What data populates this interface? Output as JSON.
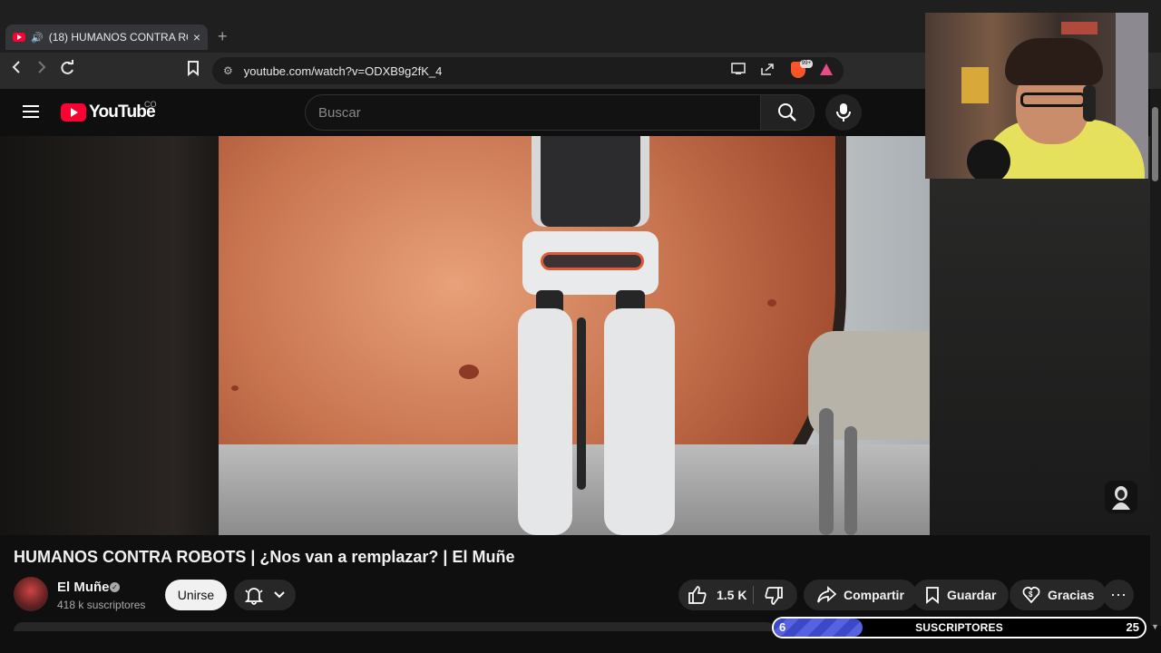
{
  "browser": {
    "tab_title": "(18) HUMANOS CONTRA RO",
    "tab_close": "×",
    "new_tab": "+",
    "url": "youtube.com/watch?v=ODXB9g2fK_4",
    "brave_badge": "99+"
  },
  "youtube": {
    "logo_text": "YouTube",
    "country_code": "CO",
    "search_placeholder": "Buscar"
  },
  "video": {
    "title": "HUMANOS CONTRA ROBOTS | ¿Nos van a remplazar? | El Muñe",
    "channel_name": "El Muñe",
    "subscribers": "418 k suscriptores",
    "join_label": "Unirse",
    "likes": "1.5 K",
    "share_label": "Compartir",
    "save_label": "Guardar",
    "thanks_label": "Gracias",
    "more_label": "⋯"
  },
  "subscriber_goal": {
    "current": "6",
    "label": "SUSCRIPTORES",
    "target": "25",
    "progress_fraction": 0.24
  },
  "colors": {
    "accent_red": "#ff0033",
    "goal_fill": "#3b48c8",
    "background": "#0f0f0f"
  },
  "icons": [
    "back-icon",
    "forward-icon",
    "reload-icon",
    "bookmark-icon",
    "site-settings-icon",
    "cast-icon",
    "share-page-icon",
    "brave-shield-icon",
    "brave-rewards-icon",
    "hamburger-menu-icon",
    "search-icon",
    "microphone-icon",
    "bell-icon",
    "chevron-down-icon",
    "thumbs-up-icon",
    "thumbs-down-icon",
    "share-icon",
    "save-icon",
    "thanks-icon",
    "more-icon",
    "verified-icon"
  ]
}
